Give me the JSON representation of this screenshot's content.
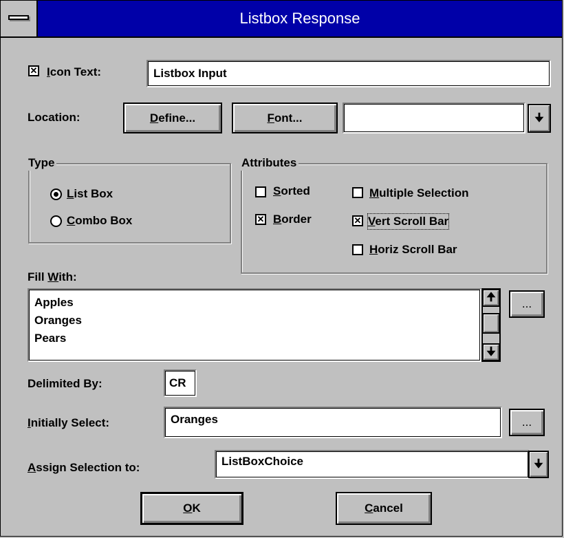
{
  "window": {
    "title": "Listbox Response"
  },
  "icon_text": {
    "checked": true,
    "label": "Icon Text:",
    "value": "Listbox Input"
  },
  "location": {
    "label": "Location:",
    "define_button": "Define...",
    "font_button": "Font...",
    "dropdown_value": ""
  },
  "type_group": {
    "legend": "Type",
    "options": [
      {
        "label": "List Box",
        "selected": true
      },
      {
        "label": "Combo Box",
        "selected": false
      }
    ]
  },
  "attributes_group": {
    "legend": "Attributes",
    "sorted": {
      "label": "Sorted",
      "checked": false
    },
    "border": {
      "label": "Border",
      "checked": true
    },
    "multiple_selection": {
      "label": "Multiple Selection",
      "checked": false
    },
    "vert_scroll_bar": {
      "label": "Vert Scroll Bar",
      "checked": true
    },
    "horiz_scroll_bar": {
      "label": "Horiz Scroll Bar",
      "checked": false
    }
  },
  "fill_with": {
    "label": "Fill With:",
    "items": [
      "Apples",
      "Oranges",
      "Pears"
    ],
    "browse_button": "..."
  },
  "delimited_by": {
    "label": "Delimited By:",
    "value": "CR"
  },
  "initially_select": {
    "label": "Initially Select:",
    "value": "Oranges",
    "browse_button": "..."
  },
  "assign_selection": {
    "label": "Assign Selection to:",
    "value": "ListBoxChoice"
  },
  "buttons": {
    "ok": "OK",
    "cancel": "Cancel"
  },
  "glyphs": {
    "check_mark": "✕",
    "arrow_up": "🠉",
    "arrow_down": "🠋"
  }
}
